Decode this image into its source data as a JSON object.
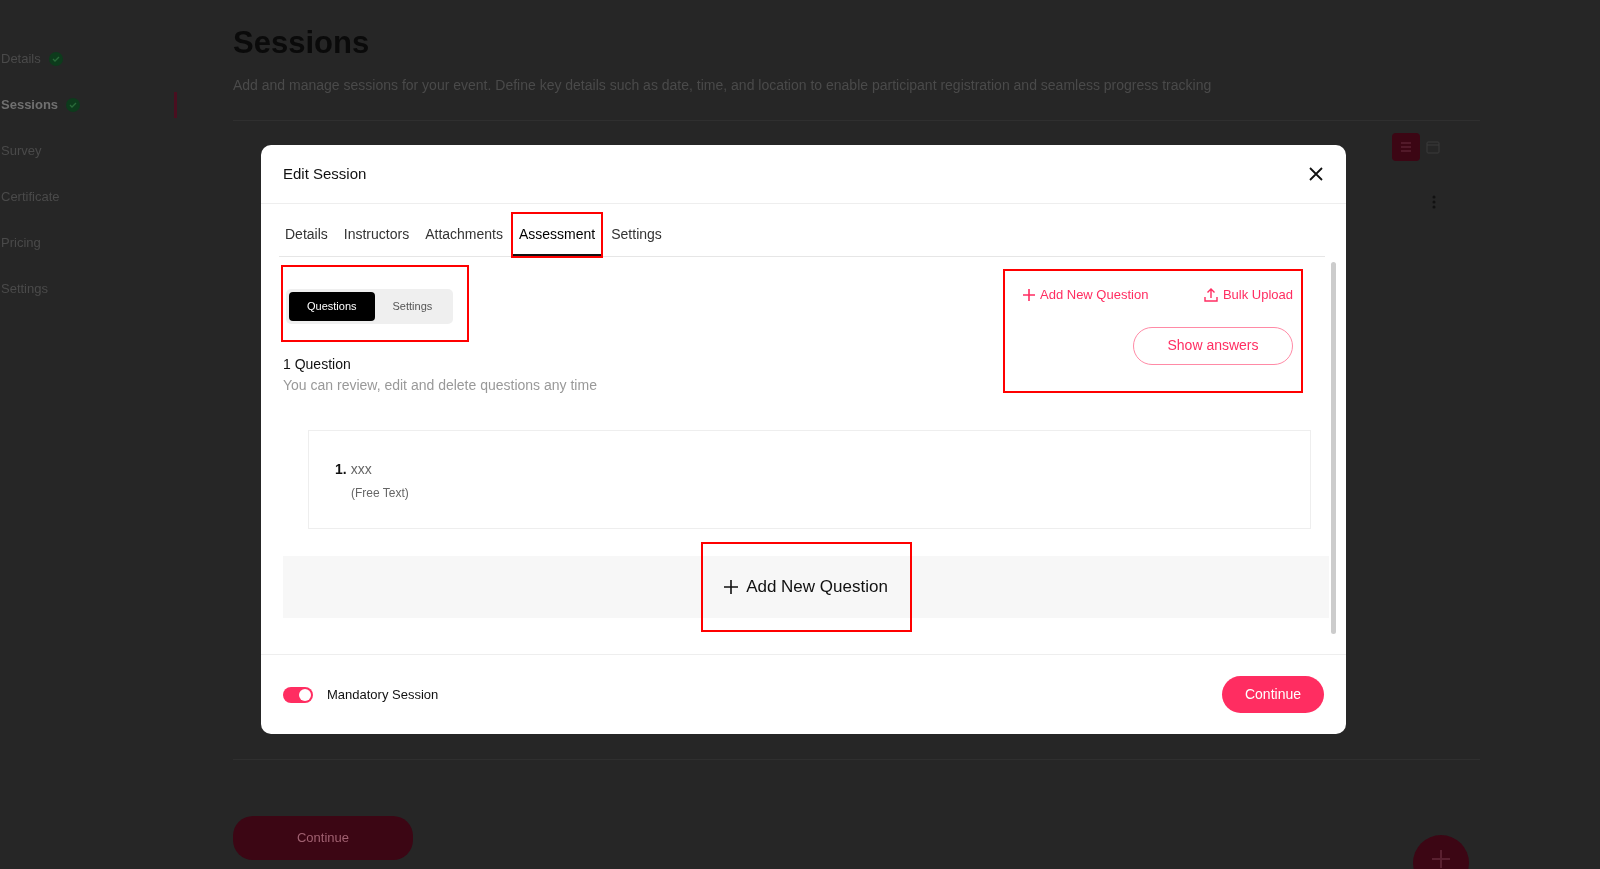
{
  "sidebar": {
    "items": [
      {
        "label": "Details",
        "done": true,
        "selected": false
      },
      {
        "label": "Sessions",
        "done": true,
        "selected": true
      },
      {
        "label": "Survey",
        "done": false,
        "selected": false
      },
      {
        "label": "Certificate",
        "done": false,
        "selected": false
      },
      {
        "label": "Pricing",
        "done": false,
        "selected": false
      },
      {
        "label": "Settings",
        "done": false,
        "selected": false
      }
    ]
  },
  "page": {
    "title": "Sessions",
    "description": "Add and manage sessions for your event. Define key details such as date, time, and location to enable participant registration and seamless progress tracking",
    "continue": "Continue"
  },
  "modal": {
    "title": "Edit Session",
    "tabs": [
      {
        "label": "Details",
        "selected": false,
        "highlighted": false
      },
      {
        "label": "Instructors",
        "selected": false,
        "highlighted": false
      },
      {
        "label": "Attachments",
        "selected": false,
        "highlighted": false
      },
      {
        "label": "Assessment",
        "selected": true,
        "highlighted": true
      },
      {
        "label": "Settings",
        "selected": false,
        "highlighted": false
      }
    ],
    "segments": {
      "highlighted": true,
      "items": [
        {
          "label": "Questions",
          "selected": true
        },
        {
          "label": "Settings",
          "selected": false
        }
      ]
    },
    "actions": {
      "highlighted": true,
      "add": "Add New Question",
      "upload": "Bulk Upload",
      "show_answers": "Show answers"
    },
    "count": "1 Question",
    "hint": "You can review, edit and delete questions any time",
    "questions": [
      {
        "number": "1.",
        "text": "xxx",
        "type": "(Free Text)"
      }
    ],
    "add_button": {
      "label": "Add New Question",
      "highlighted": true
    },
    "mandatory": {
      "label": "Mandatory Session",
      "on": true
    },
    "continue": "Continue"
  }
}
